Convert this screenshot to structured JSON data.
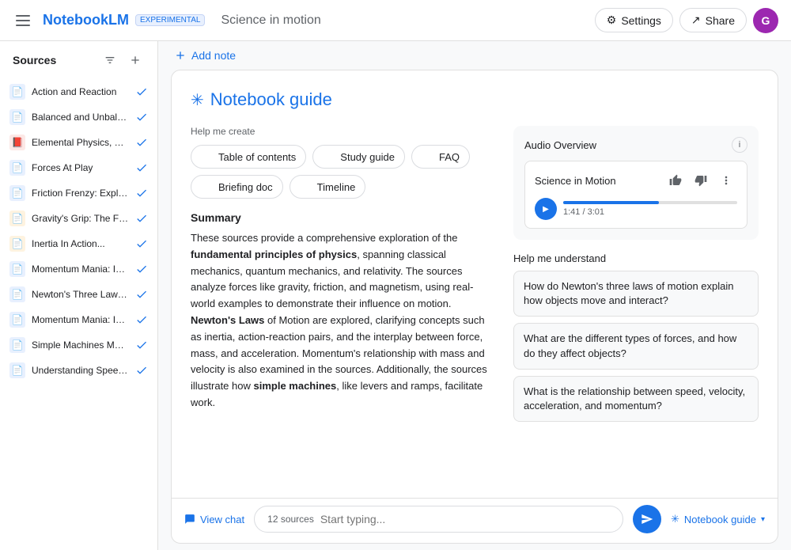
{
  "topNav": {
    "hamburger": "menu",
    "logoText": "NotebookLM",
    "logoBadge": "EXPERIMENTAL",
    "titleDivider": "·",
    "title": "Science in motion",
    "settingsLabel": "Settings",
    "shareLabel": "Share",
    "avatarInitial": "G"
  },
  "sidebar": {
    "title": "Sources",
    "filterIcon": "filter",
    "addIcon": "add",
    "sources": [
      {
        "label": "Action and Reaction",
        "iconType": "blue",
        "iconChar": "≡",
        "checked": true
      },
      {
        "label": "Balanced and Unbalance...",
        "iconType": "blue",
        "iconChar": "≡",
        "checked": true
      },
      {
        "label": "Elemental Physics, Third...",
        "iconType": "red",
        "iconChar": "▣",
        "checked": true
      },
      {
        "label": "Forces At Play",
        "iconType": "blue",
        "iconChar": "≡",
        "checked": true
      },
      {
        "label": "Friction Frenzy: Explorin...",
        "iconType": "blue",
        "iconChar": "≡",
        "checked": true
      },
      {
        "label": "Gravity's Grip: The Force...",
        "iconType": "orange",
        "iconChar": "≡",
        "checked": true
      },
      {
        "label": "Inertia In Action...",
        "iconType": "orange",
        "iconChar": "≡",
        "checked": true
      },
      {
        "label": "Momentum Mania: Inves...",
        "iconType": "blue",
        "iconChar": "≡",
        "checked": true
      },
      {
        "label": "Newton's Three Laws...",
        "iconType": "blue",
        "iconChar": "≡",
        "checked": true
      },
      {
        "label": "Momentum Mania: Inves...",
        "iconType": "blue",
        "iconChar": "≡",
        "checked": true
      },
      {
        "label": "Simple Machines Make...",
        "iconType": "blue",
        "iconChar": "≡",
        "checked": true
      },
      {
        "label": "Understanding Speed, Ve...",
        "iconType": "blue",
        "iconChar": "≡",
        "checked": true
      }
    ]
  },
  "contentArea": {
    "addNoteLabel": "Add note"
  },
  "notebookGuide": {
    "starChar": "✳",
    "title": "Notebook guide",
    "helpCreateLabel": "Help me create",
    "createButtons": [
      {
        "icon": "☰",
        "label": "Table of contents"
      },
      {
        "icon": "📖",
        "label": "Study guide"
      },
      {
        "icon": "❓",
        "label": "FAQ"
      },
      {
        "icon": "📋",
        "label": "Briefing doc"
      },
      {
        "icon": "⏱",
        "label": "Timeline"
      }
    ],
    "summaryTitle": "Summary",
    "summaryParts": [
      {
        "text": "These sources provide a comprehensive exploration of the ",
        "bold": false
      },
      {
        "text": "fundamental principles of physics",
        "bold": true
      },
      {
        "text": ", spanning classical mechanics, quantum mechanics, and relativity. The sources analyze forces like gravity, friction, and magnetism, using real-world examples to demonstrate their influence on motion. ",
        "bold": false
      },
      {
        "text": "Newton's Laws",
        "bold": true
      },
      {
        "text": " of Motion are explored, clarifying concepts such as inertia, action-reaction pairs, and the interplay between force, mass, and acceleration. Momentum's relationship with mass and velocity is also examined in the sources. Additionally, the sources illustrate how ",
        "bold": false
      },
      {
        "text": "simple machines",
        "bold": true
      },
      {
        "text": ", like levers and ramps, facilitate work.",
        "bold": false
      }
    ],
    "audioOverview": {
      "label": "Audio Overview",
      "infoChar": "i",
      "cardTitle": "Science in Motion",
      "thumbUpChar": "👍",
      "thumbDownChar": "👎",
      "moreChar": "⋯",
      "playChar": "▶",
      "progressPercent": 55,
      "timeLabel": "1:41 / 3:01"
    },
    "helpUnderstand": {
      "label": "Help me understand",
      "questions": [
        "How do Newton's three laws of motion explain how objects move and interact?",
        "What are the different types of forces, and how do they affect objects?",
        "What is the relationship between speed, velocity, acceleration, and momentum?"
      ]
    }
  },
  "bottomBar": {
    "viewChatLabel": "View chat",
    "sourcesCount": "12 sources",
    "inputPlaceholder": "Start typing...",
    "sendChar": "➤",
    "notebookGuideLabel": "Notebook guide",
    "chevronChar": "∨"
  }
}
